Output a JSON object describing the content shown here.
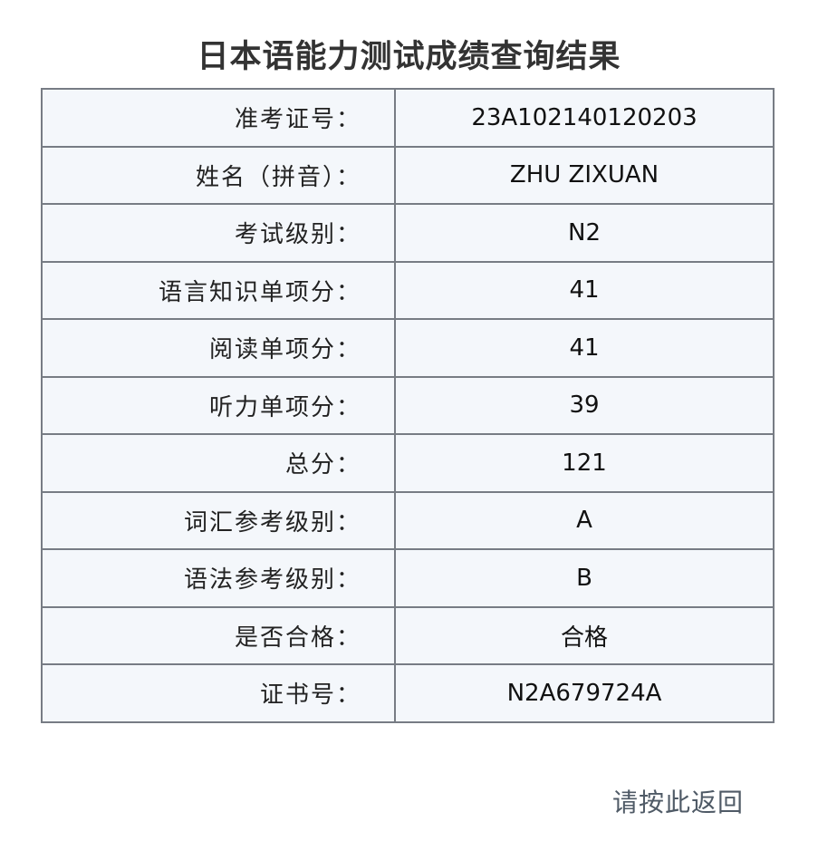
{
  "page": {
    "title": "日本语能力测试成绩查询结果",
    "back_link": "请按此返回"
  },
  "results": {
    "rows": [
      {
        "label": "准考证号：",
        "value": "23A102140120203"
      },
      {
        "label": "姓名（拼音）：",
        "value": "ZHU ZIXUAN"
      },
      {
        "label": "考试级别：",
        "value": "N2"
      },
      {
        "label": "语言知识单项分：",
        "value": "41"
      },
      {
        "label": "阅读单项分：",
        "value": "41"
      },
      {
        "label": "听力单项分：",
        "value": "39"
      },
      {
        "label": "总分：",
        "value": "121"
      },
      {
        "label": "词汇参考级别：",
        "value": "A"
      },
      {
        "label": "语法参考级别：",
        "value": "B"
      },
      {
        "label": "是否合格：",
        "value": "合格"
      },
      {
        "label": "证书号：",
        "value": "N2A679724A"
      }
    ]
  }
}
